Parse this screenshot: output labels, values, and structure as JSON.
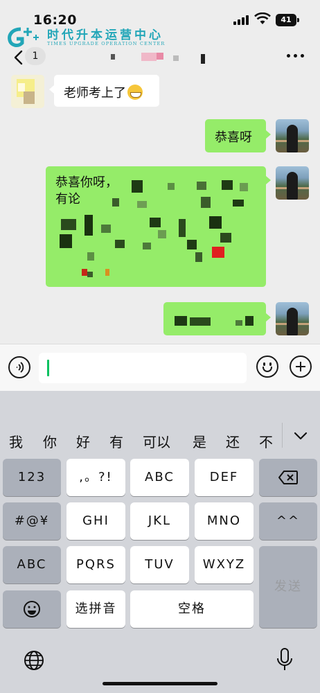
{
  "status_bar": {
    "time": "16:20",
    "battery": "41"
  },
  "watermark": {
    "title": "时代升本运营中心",
    "subtitle": "TIMES UPGRADE OPERATION CENTER"
  },
  "nav": {
    "unread_badge": "1",
    "back_icon": "chevron-left-icon",
    "more_icon": "more-dots-icon"
  },
  "messages": [
    {
      "side": "left",
      "text": "老师考上了",
      "emoji": "grinning-face-emoji"
    },
    {
      "side": "right",
      "text": "恭喜呀"
    },
    {
      "side": "right",
      "line1": "恭喜你呀，",
      "line2": "有论"
    },
    {
      "side": "right",
      "text": ""
    }
  ],
  "input_bar": {
    "voice_icon": "voice-icon",
    "emoji_icon": "smile-icon",
    "add_icon": "plus-icon"
  },
  "keyboard": {
    "candidates": [
      "我",
      "你",
      "好",
      "有",
      "可以",
      "是",
      "还",
      "不"
    ],
    "rows": {
      "left": [
        "123",
        "#@¥",
        "ABC"
      ],
      "row1": [
        ",。?!",
        "ABC",
        "DEF"
      ],
      "row2": [
        "GHI",
        "JKL",
        "MNO"
      ],
      "row3": [
        "PQRS",
        "TUV",
        "WXYZ"
      ],
      "right_caret": "^^",
      "pinyin": "选拼音",
      "space": "空格",
      "send": "发送"
    }
  },
  "colors": {
    "bubble_green": "#95ec69",
    "chat_bg": "#ededed",
    "keyboard_bg": "#d3d5da",
    "caret": "#07c160",
    "watermark": "#22a6b8"
  }
}
